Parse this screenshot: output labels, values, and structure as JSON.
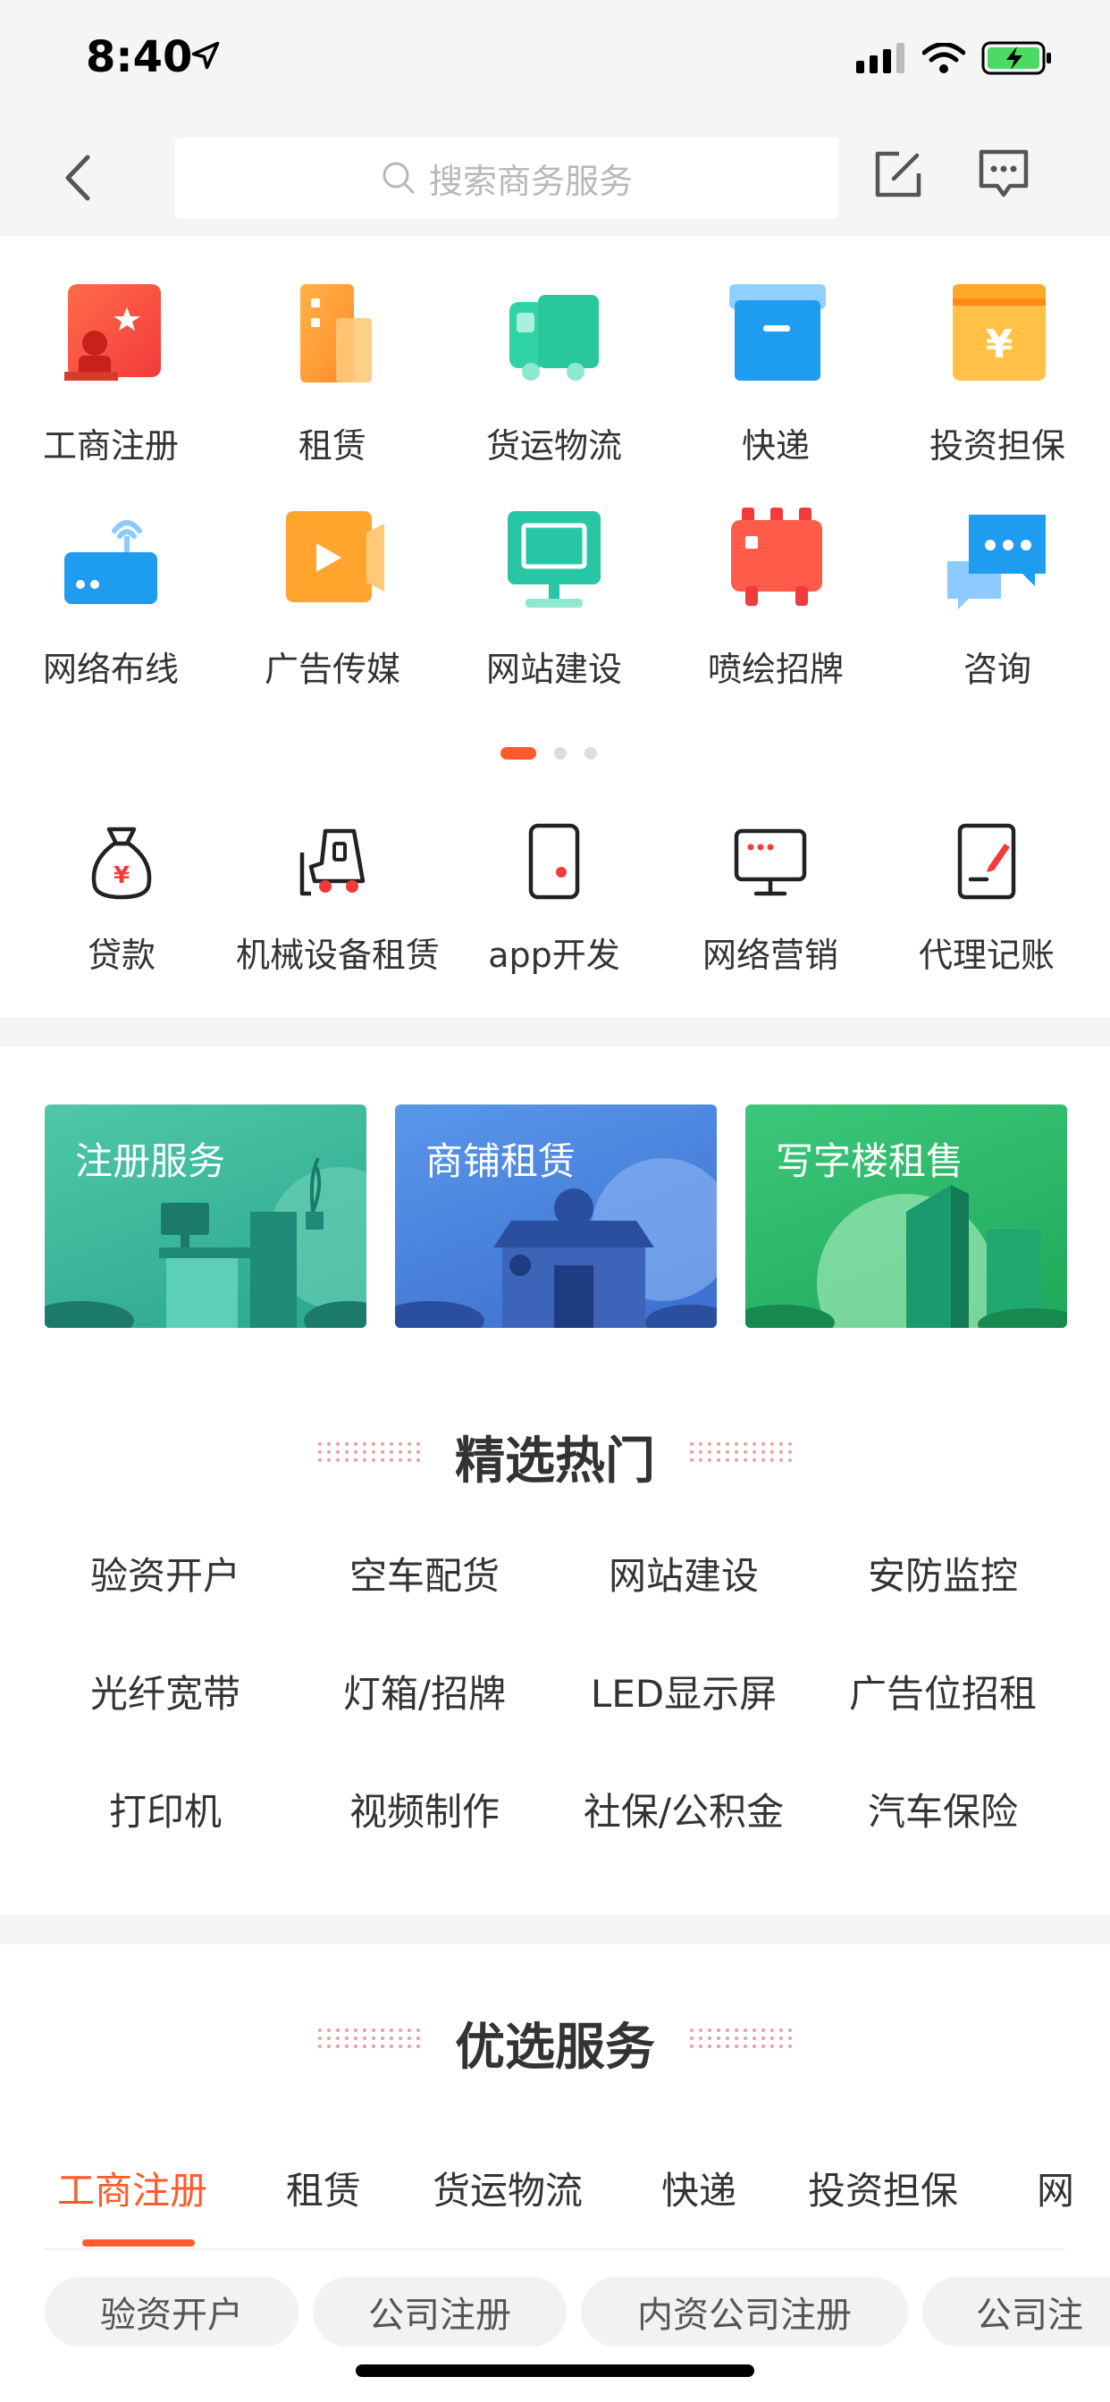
{
  "status": {
    "time": "8:40"
  },
  "search": {
    "placeholder": "搜索商务服务"
  },
  "categories": [
    {
      "label": "工商注册",
      "icon": "business-registration-icon"
    },
    {
      "label": "租赁",
      "icon": "rental-icon"
    },
    {
      "label": "货运物流",
      "icon": "truck-icon"
    },
    {
      "label": "快递",
      "icon": "box-icon"
    },
    {
      "label": "投资担保",
      "icon": "yuan-wallet-icon"
    },
    {
      "label": "网络布线",
      "icon": "router-icon"
    },
    {
      "label": "广告传媒",
      "icon": "video-play-icon"
    },
    {
      "label": "网站建设",
      "icon": "monitor-icon"
    },
    {
      "label": "喷绘招牌",
      "icon": "signboard-icon"
    },
    {
      "label": "咨询",
      "icon": "chat-bubbles-icon"
    }
  ],
  "quick": [
    {
      "label": "贷款",
      "icon": "money-bag-icon"
    },
    {
      "label": "机械设备租赁",
      "icon": "forklift-icon"
    },
    {
      "label": "app开发",
      "icon": "phone-icon"
    },
    {
      "label": "网络营销",
      "icon": "screen-icon"
    },
    {
      "label": "代理记账",
      "icon": "document-pen-icon"
    }
  ],
  "banners": [
    {
      "title": "注册服务",
      "color": "#3cb99a"
    },
    {
      "title": "商铺租赁",
      "color": "#4a84dc"
    },
    {
      "title": "写字楼租售",
      "color": "#2fb464"
    }
  ],
  "hot": {
    "title": "精选热门",
    "items": [
      "验资开户",
      "空车配货",
      "网站建设",
      "安防监控",
      "光纤宽带",
      "灯箱/招牌",
      "LED显示屏",
      "广告位招租",
      "打印机",
      "视频制作",
      "社保/公积金",
      "汽车保险"
    ]
  },
  "preferred": {
    "title": "优选服务",
    "tabs": [
      "工商注册",
      "租赁",
      "货运物流",
      "快递",
      "投资担保",
      "网"
    ],
    "active_tab": "工商注册",
    "chips": [
      "验资开户",
      "公司注册",
      "内资公司注册",
      "公司注"
    ]
  },
  "colors": {
    "accent": "#ff5a2c"
  }
}
